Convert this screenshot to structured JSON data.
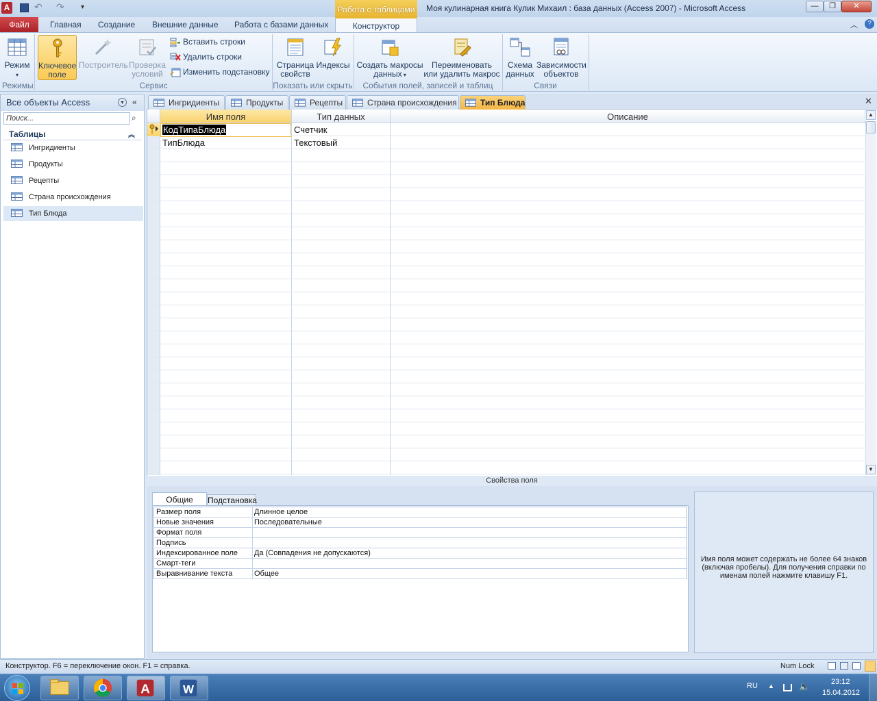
{
  "titlebar": {
    "context_tab": "Работа с таблицами",
    "title": "Моя кулинарная книга Кулик Михаил : база данных (Access 2007)  -  Microsoft Access",
    "minimize": "—",
    "restore": "❐",
    "close": "✕"
  },
  "ribbon_tabs": {
    "file": "Файл",
    "home": "Главная",
    "create": "Создание",
    "external": "Внешние данные",
    "db_tools": "Работа с базами данных",
    "constructor": "Конструктор"
  },
  "ribbon": {
    "mode": "Режим",
    "key_field_1": "Ключевое",
    "key_field_2": "поле",
    "builder": "Построитель",
    "check_1": "Проверка",
    "check_2": "условий",
    "insert_rows": "Вставить строки",
    "delete_rows": "Удалить строки",
    "change_lookup": "Изменить подстановку",
    "prop_sheet_1": "Страница",
    "prop_sheet_2": "свойств",
    "indexes": "Индексы",
    "create_macros_1": "Создать макросы",
    "create_macros_2": "данных",
    "rename_macro_1": "Переименовать",
    "rename_macro_2": "или удалить макрос",
    "schema_1": "Схема",
    "schema_2": "данных",
    "deps_1": "Зависимости",
    "deps_2": "объектов",
    "group_modes": "Режимы",
    "group_service": "Сервис",
    "group_show": "Показать или скрыть",
    "group_events": "События полей, записей и таблиц",
    "group_links": "Связи"
  },
  "nav": {
    "header": "Все объекты Access",
    "search_placeholder": "Поиск...",
    "group": "Таблицы",
    "items": [
      "Ингридиенты",
      "Продукты",
      "Рецепты",
      "Страна происхождения",
      "Тип Блюда"
    ]
  },
  "doc_tabs": [
    "Ингридиенты",
    "Продукты",
    "Рецепты",
    "Страна происхождения",
    "Тип Блюда"
  ],
  "grid": {
    "headers": [
      "Имя поля",
      "Тип данных",
      "Описание"
    ],
    "rows": [
      {
        "name": "КодТипаБлюда",
        "type": "Счетчик",
        "desc": ""
      },
      {
        "name": "ТипБлюда",
        "type": "Текстовый",
        "desc": ""
      }
    ]
  },
  "props": {
    "label": "Свойства поля",
    "tab_general": "Общие",
    "tab_lookup": "Подстановка",
    "rows": [
      {
        "label": "Размер поля",
        "value": "Длинное целое"
      },
      {
        "label": "Новые значения",
        "value": "Последовательные"
      },
      {
        "label": "Формат поля",
        "value": ""
      },
      {
        "label": "Подпись",
        "value": ""
      },
      {
        "label": "Индексированное поле",
        "value": "Да (Совпадения не допускаются)"
      },
      {
        "label": "Смарт-теги",
        "value": ""
      },
      {
        "label": "Выравнивание текста",
        "value": "Общее"
      }
    ],
    "help": "Имя поля может содержать не более 64 знаков (включая пробелы). Для получения справки по именам полей нажмите клавишу F1."
  },
  "status": {
    "text": "Конструктор.  F6 = переключение окон.  F1 = справка.",
    "numlock": "Num Lock"
  },
  "taskbar": {
    "lang": "RU",
    "time": "23:12",
    "date": "15.04.2012"
  },
  "colors": {
    "accent": "#e8b632",
    "file_tab": "#b9262d",
    "selected_row": "#fbd27a"
  }
}
